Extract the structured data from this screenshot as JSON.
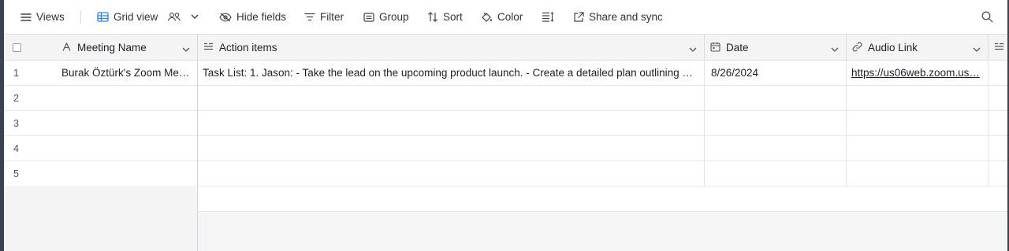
{
  "toolbar": {
    "views_label": "Views",
    "grid_view_label": "Grid view",
    "hide_fields_label": "Hide fields",
    "filter_label": "Filter",
    "group_label": "Group",
    "sort_label": "Sort",
    "color_label": "Color",
    "share_label": "Share and sync"
  },
  "columns": [
    {
      "label": "Meeting Name",
      "icon": "text-field-icon"
    },
    {
      "label": "Action items",
      "icon": "long-text-icon"
    },
    {
      "label": "Date",
      "icon": "calendar-icon"
    },
    {
      "label": "Audio Link",
      "icon": "link-icon"
    }
  ],
  "rows": [
    {
      "num": "1",
      "meeting_name": "Burak Öztürk's Zoom Me…",
      "action_items": "Task List: 1. Jason: - Take the lead on the upcoming product launch. - Create a detailed plan outlining …",
      "date": "8/26/2024",
      "audio_link": "https://us06web.zoom.us…"
    },
    {
      "num": "2",
      "meeting_name": "",
      "action_items": "",
      "date": "",
      "audio_link": ""
    },
    {
      "num": "3",
      "meeting_name": "",
      "action_items": "",
      "date": "",
      "audio_link": ""
    },
    {
      "num": "4",
      "meeting_name": "",
      "action_items": "",
      "date": "",
      "audio_link": ""
    },
    {
      "num": "5",
      "meeting_name": "",
      "action_items": "",
      "date": "",
      "audio_link": ""
    }
  ],
  "add_row_symbol": "+"
}
